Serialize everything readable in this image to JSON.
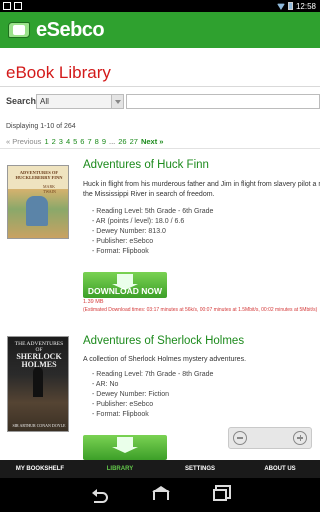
{
  "status_bar": {
    "time": "12:58"
  },
  "app": {
    "name": "eSebco"
  },
  "page": {
    "title": "eBook Library"
  },
  "search": {
    "label": "Search:",
    "filter_value": "All",
    "query": ""
  },
  "pagination": {
    "displaying": "Displaying 1-10 of 264",
    "previous": "« Previous",
    "pages": [
      "1",
      "2",
      "3",
      "4",
      "5",
      "6",
      "7",
      "8",
      "9"
    ],
    "ellipsis": "...",
    "last_pages": [
      "26",
      "27"
    ],
    "next": "Next »"
  },
  "books": [
    {
      "title": "Adventures of Huck Finn",
      "cover_title": "ADVENTURES OF HUCKLEBERRY FINN",
      "cover_author": "MARK TWAIN",
      "description_lines": [
        "Huck in flight from his murderous father and Jim in flight from slavery pilot a raft thro",
        "the Mississippi River in search of freedom."
      ],
      "meta": [
        "Reading Level: 5th Grade - 6th Grade",
        "AR (points / level): 18.0 / 6.6",
        "Dewey Number: 813.0",
        "Publisher: eSebco",
        "Format: Flipbook"
      ],
      "download_label": "DOWNLOAD NOW",
      "size": "1.39 MB",
      "estimate": "(Estimated Download times: 03:17 minutes at 56k/s, 00:07 minutes at 1.5Mbit/s, 00:02 minutes at 5Mbit/s)"
    },
    {
      "title": "Adventures of Sherlock Holmes",
      "cover_title_top": "THE ADVENTURES OF",
      "cover_title_main": "SHERLOCK HOLMES",
      "cover_author": "SIR ARTHUR CONAN DOYLE",
      "description_lines": [
        "A collection of Sherlock Holmes mystery adventures."
      ],
      "meta": [
        "Reading Level: 7th Grade - 8th Grade",
        "AR: No",
        "Dewey Number: Fiction",
        "Publisher: eSebco",
        "Format: Flipbook"
      ]
    }
  ],
  "bottom_nav": {
    "items": [
      "MY BOOKSHELF",
      "LIBRARY",
      "SETTINGS",
      "ABOUT US"
    ],
    "active": "LIBRARY"
  },
  "colors": {
    "header_green": "#2fa12f",
    "title_red": "#d31a1a",
    "link_green": "#1c8a1c",
    "active_nav": "#63c84a"
  }
}
